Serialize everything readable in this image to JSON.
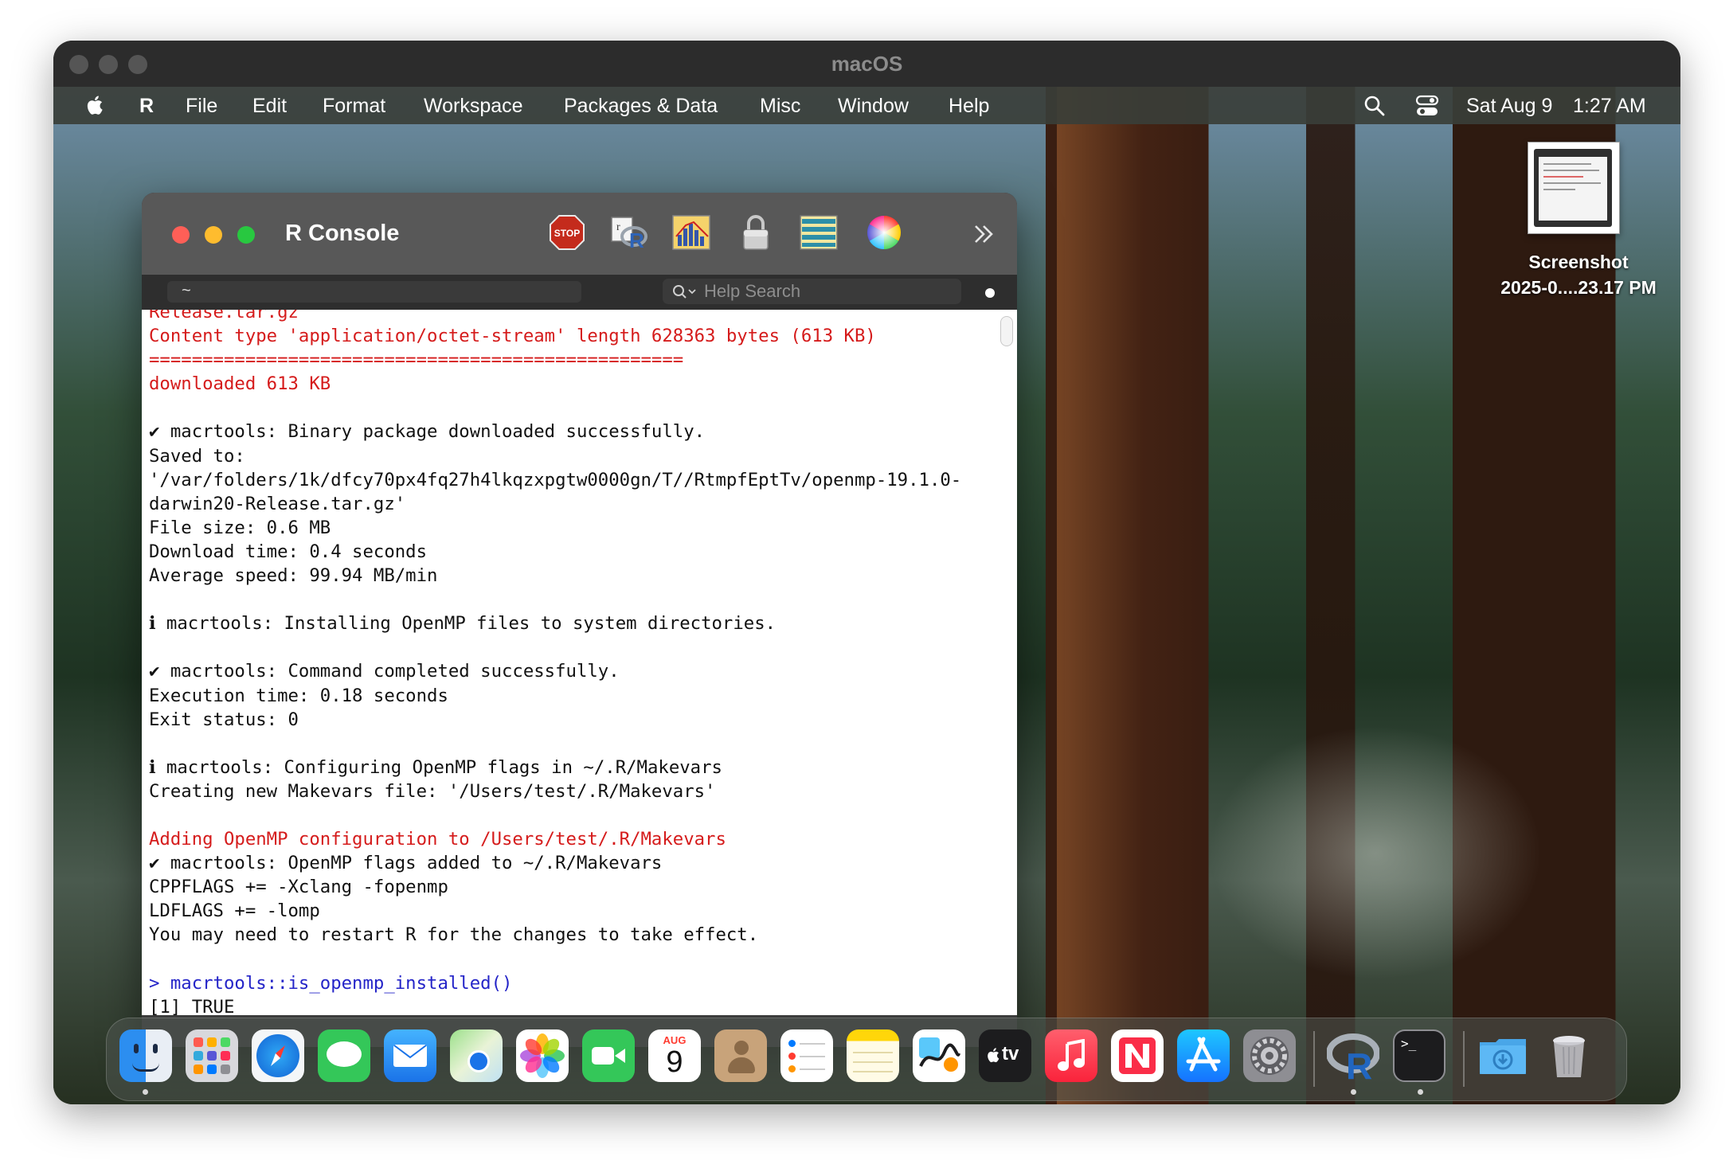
{
  "frame": {
    "title": "macOS"
  },
  "menubar": {
    "items": [
      "R",
      "File",
      "Edit",
      "Format",
      "Workspace",
      "Packages & Data",
      "Misc",
      "Window",
      "Help"
    ],
    "date": "Sat Aug 9",
    "time": "1:27 AM"
  },
  "console_window": {
    "title": "R Console",
    "toolbar": {
      "stop_label": "STOP",
      "icons": [
        "stop-icon",
        "r-source-icon",
        "quartz-icon",
        "lock-icon",
        "data-table-icon",
        "color-wheel-icon",
        "overflow-chevron-icon"
      ]
    },
    "path_value": "~",
    "help_search_placeholder": "Help Search",
    "lines": [
      {
        "text": "Release.tar.gz",
        "color": "red"
      },
      {
        "text": "Content type 'application/octet-stream' length 628363 bytes (613 KB)",
        "color": "red"
      },
      {
        "text": "==================================================",
        "color": "red"
      },
      {
        "text": "downloaded 613 KB",
        "color": "red"
      },
      {
        "text": "",
        "color": "black"
      },
      {
        "text": "✔ macrtools: Binary package downloaded successfully.",
        "color": "black"
      },
      {
        "text": "Saved to:",
        "color": "black"
      },
      {
        "text": "'/var/folders/1k/dfcy70px4fq27h4lkqzxpgtw0000gn/T//RtmpfEptTv/openmp-19.1.0-",
        "color": "black"
      },
      {
        "text": "darwin20-Release.tar.gz'",
        "color": "black"
      },
      {
        "text": "File size: 0.6 MB",
        "color": "black"
      },
      {
        "text": "Download time: 0.4 seconds",
        "color": "black"
      },
      {
        "text": "Average speed: 99.94 MB/min",
        "color": "black"
      },
      {
        "text": "",
        "color": "black"
      },
      {
        "text": "ℹ macrtools: Installing OpenMP files to system directories.",
        "color": "black"
      },
      {
        "text": "",
        "color": "black"
      },
      {
        "text": "✔ macrtools: Command completed successfully.",
        "color": "black"
      },
      {
        "text": "Execution time: 0.18 seconds",
        "color": "black"
      },
      {
        "text": "Exit status: 0",
        "color": "black"
      },
      {
        "text": "",
        "color": "black"
      },
      {
        "text": "ℹ macrtools: Configuring OpenMP flags in ~/.R/Makevars",
        "color": "black"
      },
      {
        "text": "Creating new Makevars file: '/Users/test/.R/Makevars'",
        "color": "black"
      },
      {
        "text": "",
        "color": "black"
      },
      {
        "text": "Adding OpenMP configuration to /Users/test/.R/Makevars",
        "color": "red"
      },
      {
        "text": "✔ macrtools: OpenMP flags added to ~/.R/Makevars",
        "color": "black"
      },
      {
        "text": "CPPFLAGS += -Xclang -fopenmp",
        "color": "black"
      },
      {
        "text": "LDFLAGS += -lomp",
        "color": "black"
      },
      {
        "text": "You may need to restart R for the changes to take effect.",
        "color": "black"
      },
      {
        "text": "",
        "color": "black"
      },
      {
        "text": "> macrtools::is_openmp_installed()",
        "color": "blue"
      },
      {
        "text": "[1] TRUE",
        "color": "black"
      }
    ]
  },
  "desktop": {
    "screenshot_file": {
      "line1": "Screenshot",
      "line2": "2025-0....23.17 PM"
    }
  },
  "dock": {
    "calendar_month": "AUG",
    "calendar_day": "9",
    "tv_label": "tv",
    "apps": [
      "Finder",
      "Launchpad",
      "Safari",
      "Messages",
      "Mail",
      "Maps",
      "Photos",
      "FaceTime",
      "Calendar",
      "Contacts",
      "Reminders",
      "Notes",
      "Freeform",
      "TV",
      "Music",
      "News",
      "App Store",
      "System Settings",
      "R",
      "Terminal",
      "Downloads",
      "Trash"
    ]
  }
}
